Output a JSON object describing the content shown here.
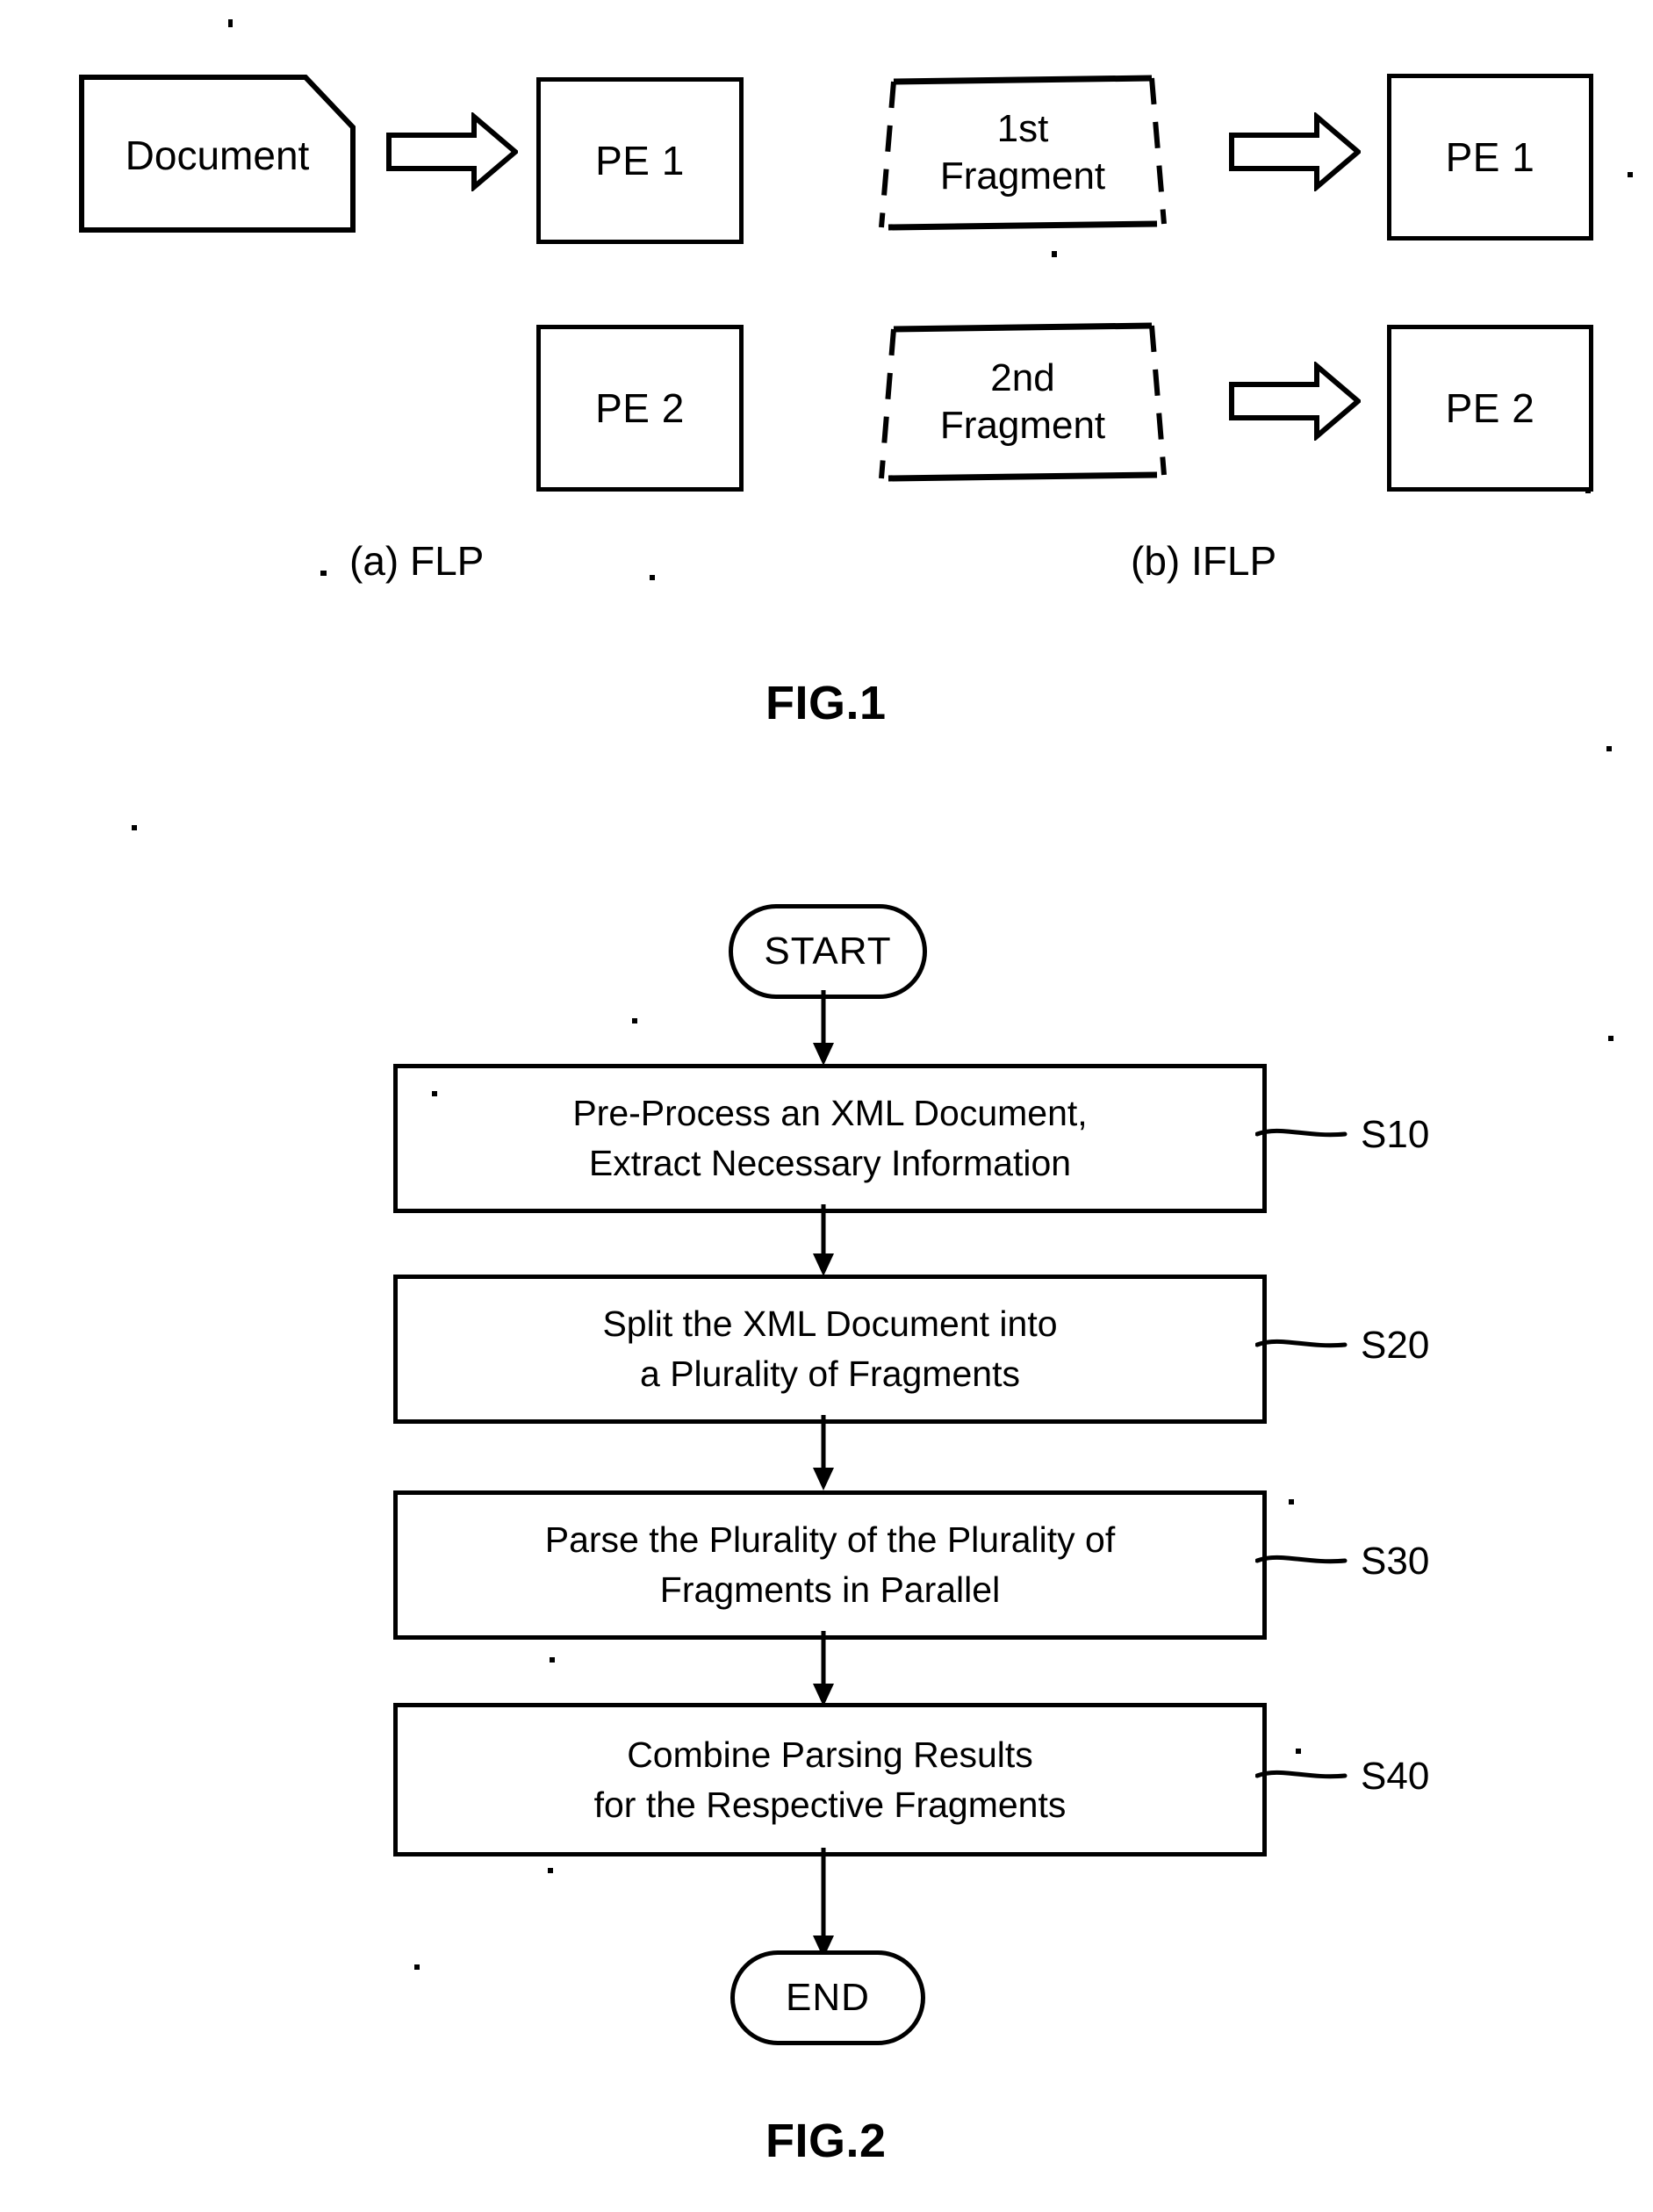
{
  "figure1": {
    "caption": "FIG.1",
    "panels": [
      {
        "key": "flp",
        "label": "(a) FLP",
        "source_shape": "document-shape",
        "source_label": "Document",
        "arrow": "block-arrow-right",
        "targets": [
          "PE 1",
          "PE 2"
        ]
      },
      {
        "key": "iflp",
        "label": "(b) IFLP",
        "source_shape": "fragment-shape",
        "fragments": [
          "1st\nFragment",
          "2nd\nFragment"
        ],
        "fragment_lines": [
          [
            "1st",
            "Fragment"
          ],
          [
            "2nd",
            "Fragment"
          ]
        ],
        "arrow": "block-arrow-right",
        "targets": [
          "PE 1",
          "PE 2"
        ]
      }
    ],
    "pe1_label": "PE 1",
    "pe2_label": "PE 2",
    "document_label": "Document",
    "fragment1_line1": "1st",
    "fragment1_line2": "Fragment",
    "fragment2_line1": "2nd",
    "fragment2_line2": "Fragment",
    "flp_caption": "(a) FLP",
    "iflp_caption": "(b) IFLP"
  },
  "figure2": {
    "caption": "FIG.2",
    "start_label": "START",
    "end_label": "END",
    "steps": [
      {
        "tag": "S10",
        "line1": "Pre-Process an XML Document,",
        "line2": "Extract Necessary Information"
      },
      {
        "tag": "S20",
        "line1": "Split the XML Document into",
        "line2": "a Plurality of Fragments"
      },
      {
        "tag": "S30",
        "line1": "Parse the Plurality of the Plurality of",
        "line2": "Fragments in Parallel"
      },
      {
        "tag": "S40",
        "line1": "Combine Parsing Results",
        "line2": "for the Respective Fragments"
      }
    ]
  },
  "colors": {
    "ink": "#000000",
    "paper": "#ffffff"
  }
}
